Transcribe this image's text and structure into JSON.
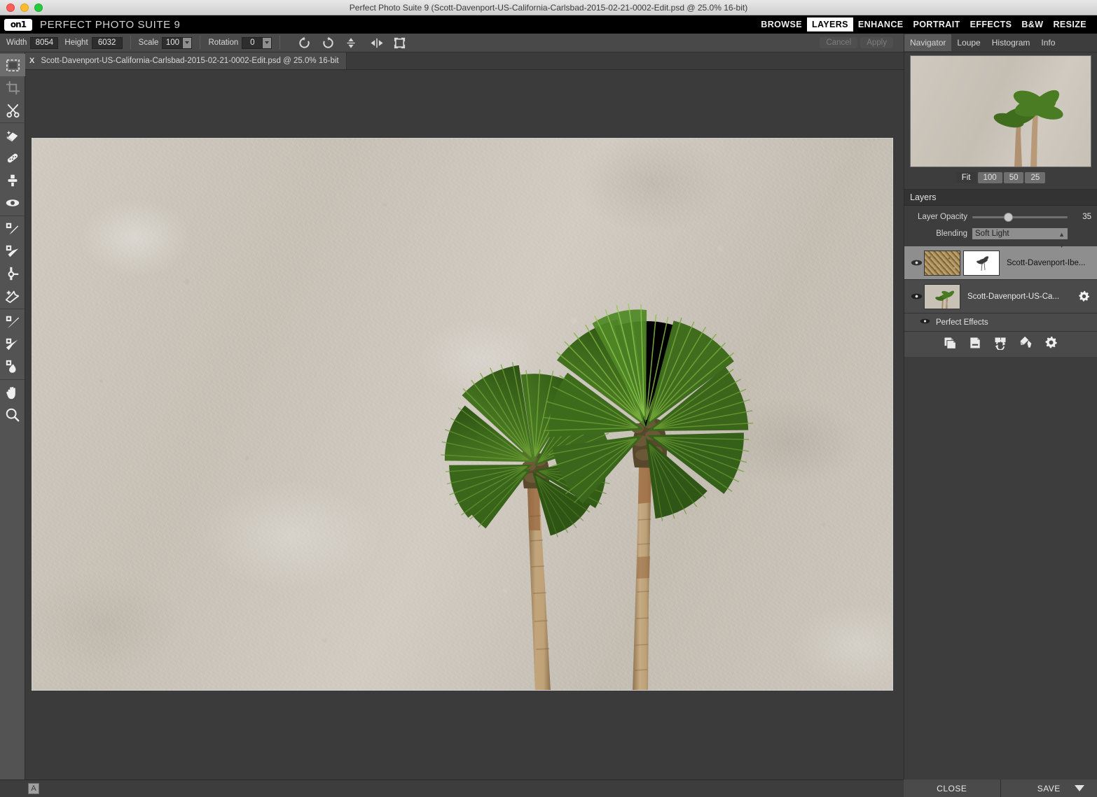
{
  "window": {
    "title": "Perfect Photo Suite 9 (Scott-Davenport-US-California-Carlsbad-2015-02-21-0002-Edit.psd @ 25.0% 16-bit)",
    "app_name": "PERFECT PHOTO SUITE 9",
    "logo_text": "on1"
  },
  "modules": [
    {
      "label": "BROWSE",
      "active": false
    },
    {
      "label": "LAYERS",
      "active": true
    },
    {
      "label": "ENHANCE",
      "active": false
    },
    {
      "label": "PORTRAIT",
      "active": false
    },
    {
      "label": "EFFECTS",
      "active": false
    },
    {
      "label": "B&W",
      "active": false
    },
    {
      "label": "RESIZE",
      "active": false
    }
  ],
  "options_bar": {
    "width_label": "Width",
    "width_value": "8054",
    "height_label": "Height",
    "height_value": "6032",
    "scale_label": "Scale",
    "scale_value": "100",
    "rotation_label": "Rotation",
    "rotation_value": "0",
    "cancel_label": "Cancel",
    "apply_label": "Apply",
    "icons": [
      "rotate-ccw-icon",
      "rotate-cw-icon",
      "flip-vertical-icon",
      "flip-horizontal-icon",
      "fit-expand-icon"
    ]
  },
  "tools": [
    {
      "name": "selection-tool",
      "selected": true,
      "dim": false
    },
    {
      "name": "crop-tool",
      "selected": false,
      "dim": true
    },
    {
      "name": "trim-tool",
      "selected": false,
      "dim": false
    },
    {
      "name": "retouch-brush-tool",
      "selected": false,
      "dim": false
    },
    {
      "name": "perfect-eraser-tool",
      "selected": false,
      "dim": false
    },
    {
      "name": "clone-stamp-tool",
      "selected": false,
      "dim": false
    },
    {
      "name": "red-eye-tool",
      "selected": false,
      "dim": false
    },
    {
      "name": "masking-brush-tool",
      "selected": false,
      "dim": false
    },
    {
      "name": "masking-bug-tool",
      "selected": false,
      "dim": false
    },
    {
      "name": "refine-brush-tool",
      "selected": false,
      "dim": false
    },
    {
      "name": "chisel-tool",
      "selected": false,
      "dim": false
    },
    {
      "name": "blur-tool",
      "selected": false,
      "dim": false
    },
    {
      "name": "adjustment-brush-tool",
      "selected": false,
      "dim": false
    },
    {
      "name": "gradient-mask-tool",
      "selected": false,
      "dim": false
    },
    {
      "name": "paint-in-tool",
      "selected": false,
      "dim": false
    },
    {
      "name": "hand-tool",
      "selected": false,
      "dim": false
    },
    {
      "name": "zoom-tool",
      "selected": false,
      "dim": false
    }
  ],
  "document_tab": {
    "close_label": "X",
    "name": "Scott-Davenport-US-California-Carlsbad-2015-02-21-0002-Edit.psd @ 25.0% 16-bit"
  },
  "navigator": {
    "tabs": [
      {
        "label": "Navigator",
        "active": true
      },
      {
        "label": "Loupe",
        "active": false
      },
      {
        "label": "Histogram",
        "active": false
      },
      {
        "label": "Info",
        "active": false
      }
    ],
    "zoom_buttons": [
      {
        "label": "Fit",
        "active": true
      },
      {
        "label": "100",
        "active": false
      },
      {
        "label": "50",
        "active": false
      },
      {
        "label": "25",
        "active": false
      }
    ]
  },
  "layers_panel": {
    "header": "Layers",
    "opacity_label": "Layer Opacity",
    "opacity_value": "35",
    "blending_label": "Blending",
    "blending_value": "Soft Light",
    "layers": [
      {
        "name": "Scott-Davenport-Ibe...",
        "selected": true,
        "has_mask": true,
        "has_gear": false,
        "thumb": "texture"
      },
      {
        "name": "Scott-Davenport-US-Ca...",
        "selected": false,
        "has_mask": false,
        "has_gear": true,
        "thumb": "palms"
      }
    ],
    "effects_row": "Perfect Effects",
    "buttons": [
      "copy-layer-icon",
      "delete-layer-icon",
      "merge-layer-icon",
      "mask-paint-icon",
      "layer-settings-icon"
    ]
  },
  "status_bar": {
    "soft_proof_label": "A"
  },
  "bottom_bar": {
    "close_label": "CLOSE",
    "save_label": "SAVE"
  },
  "colors": {
    "accent_white": "#ffffff",
    "panel_bg": "#3d3d3d",
    "toolstrip_bg": "#535353",
    "canvas_bg": "#3b3b3b",
    "selected_layer_bg": "#8e8e8e"
  }
}
